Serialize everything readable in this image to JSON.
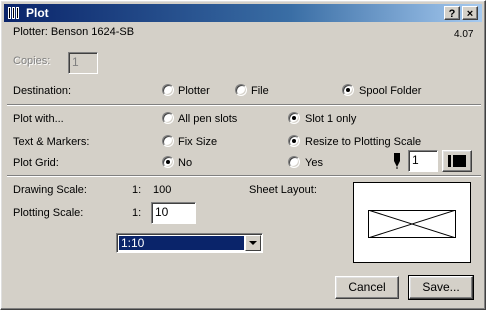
{
  "window": {
    "title": "Plot"
  },
  "title_buttons": {
    "help": "?",
    "close": "×"
  },
  "header": {
    "plotter": "Plotter: Benson 1624-SB",
    "version": "4.07"
  },
  "copies": {
    "label": "Copies:",
    "value": "1"
  },
  "destination": {
    "label": "Destination:",
    "options": [
      "Plotter",
      "File",
      "Spool Folder"
    ],
    "selected": "Spool Folder"
  },
  "plot_with": {
    "label": "Plot with...",
    "options": [
      "All pen slots",
      "Slot 1 only"
    ],
    "selected": "Slot 1 only"
  },
  "text_markers": {
    "label": "Text & Markers:",
    "options": [
      "Fix Size",
      "Resize to Plotting Scale"
    ],
    "selected": "Resize to Plotting Scale"
  },
  "plot_grid": {
    "label": "Plot Grid:",
    "options": [
      "No",
      "Yes"
    ],
    "selected": "No",
    "pen_value": "1"
  },
  "drawing_scale": {
    "label": "Drawing Scale:",
    "prefix": "1:",
    "value": "100"
  },
  "plotting_scale": {
    "label": "Plotting Scale:",
    "prefix": "1:",
    "value": "10",
    "dropdown_value": "1:10"
  },
  "sheet_layout": {
    "label": "Sheet Layout:"
  },
  "buttons": {
    "cancel": "Cancel",
    "save": "Save..."
  }
}
